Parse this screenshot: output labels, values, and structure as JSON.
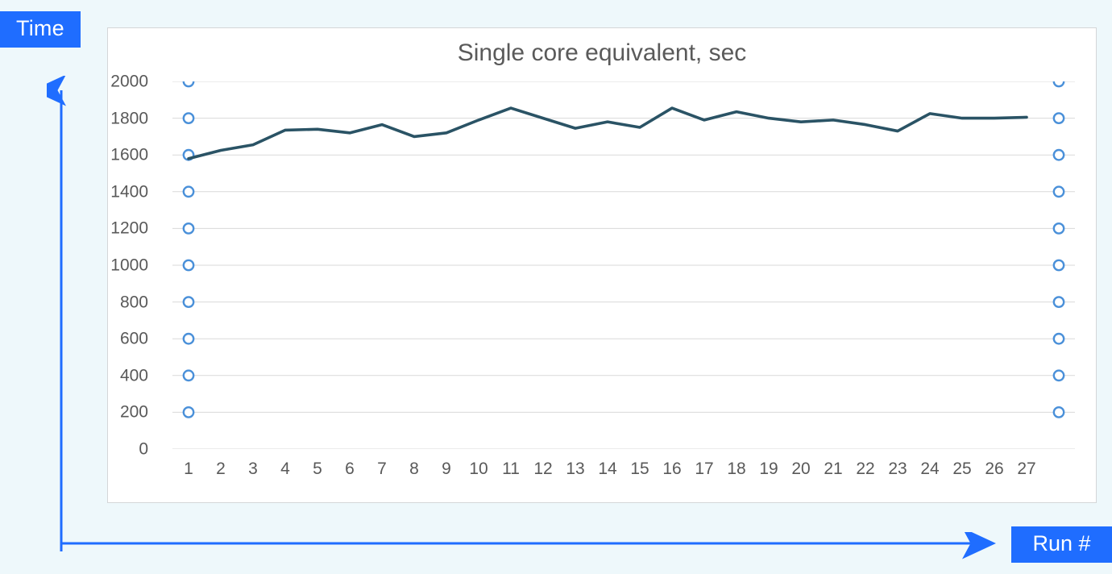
{
  "y_axis_label": "Time",
  "x_axis_label": "Run #",
  "chart_data": {
    "type": "line",
    "title": "Single core equivalent, sec",
    "xlabel": "",
    "ylabel": "",
    "categories": [
      1,
      2,
      3,
      4,
      5,
      6,
      7,
      8,
      9,
      10,
      11,
      12,
      13,
      14,
      15,
      16,
      17,
      18,
      19,
      20,
      21,
      22,
      23,
      24,
      25,
      26,
      27
    ],
    "values": [
      1580,
      1625,
      1655,
      1735,
      1740,
      1720,
      1765,
      1700,
      1720,
      1790,
      1855,
      1800,
      1745,
      1780,
      1750,
      1855,
      1790,
      1835,
      1800,
      1780,
      1790,
      1765,
      1730,
      1825,
      1800,
      1800,
      1805
    ],
    "y_ticks": [
      0,
      200,
      400,
      600,
      800,
      1000,
      1200,
      1400,
      1600,
      1800,
      2000
    ],
    "ylim": [
      0,
      2000
    ],
    "x_ticks": [
      1,
      2,
      3,
      4,
      5,
      6,
      7,
      8,
      9,
      10,
      11,
      12,
      13,
      14,
      15,
      16,
      17,
      18,
      19,
      20,
      21,
      22,
      23,
      24,
      25,
      26,
      27
    ],
    "marker_ticks_y": [
      200,
      400,
      600,
      800,
      1000,
      1200,
      1400,
      1600,
      1800,
      2000
    ],
    "marker_columns_x": [
      1,
      28
    ]
  },
  "colors": {
    "label_bg": "#1f6dff",
    "arrow": "#1f6dff",
    "grid": "#d9d9d9",
    "ticktext": "#595959",
    "line": "#2a5365",
    "marker_ring": "#4a90d9",
    "marker_fill": "#ffffff"
  }
}
